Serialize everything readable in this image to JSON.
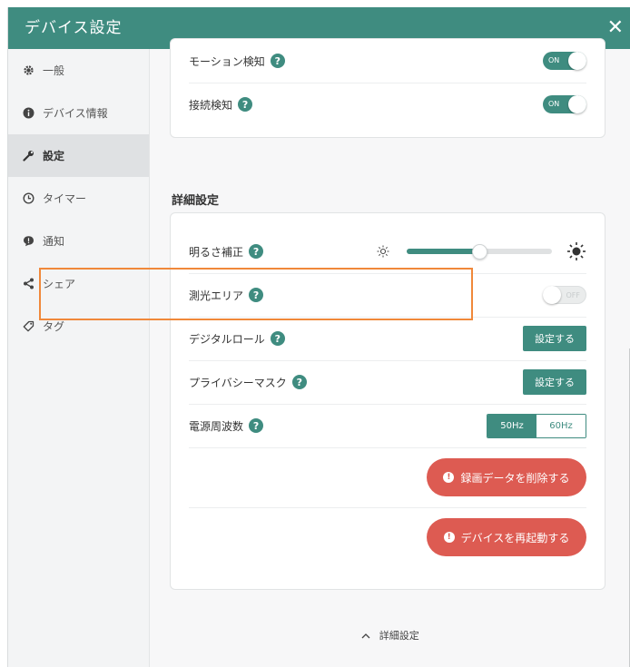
{
  "window": {
    "title": "デバイス設定",
    "close_label": "✕"
  },
  "sidebar": {
    "items": [
      {
        "label": "一般",
        "icon": "gear-icon"
      },
      {
        "label": "デバイス情報",
        "icon": "info-icon"
      },
      {
        "label": "設定",
        "icon": "wrench-icon"
      },
      {
        "label": "タイマー",
        "icon": "clock-icon"
      },
      {
        "label": "通知",
        "icon": "chat-icon"
      },
      {
        "label": "シェア",
        "icon": "share-icon"
      },
      {
        "label": "タグ",
        "icon": "tag-icon"
      }
    ],
    "active_index": 2
  },
  "detection": {
    "motion": {
      "label": "モーション検知",
      "state": "ON"
    },
    "connection": {
      "label": "接続検知",
      "state": "ON"
    }
  },
  "advanced": {
    "heading": "詳細設定",
    "brightness": {
      "label": "明るさ補正",
      "level": 0.5
    },
    "metering": {
      "label": "測光エリア",
      "state": "OFF"
    },
    "digital_roll": {
      "label": "デジタルロール",
      "button": "設定する"
    },
    "privacy_mask": {
      "label": "プライバシーマスク",
      "button": "設定する"
    },
    "power_freq": {
      "label": "電源周波数",
      "options": [
        "50Hz",
        "60Hz"
      ],
      "selected": "50Hz"
    },
    "delete_recording": "録画データを削除する",
    "restart_device": "デバイスを再起動する"
  },
  "footer": {
    "collapse_label": "詳細設定"
  },
  "colors": {
    "accent": "#3f8c80",
    "danger": "#dd5b52",
    "highlight": "#f0883a"
  }
}
